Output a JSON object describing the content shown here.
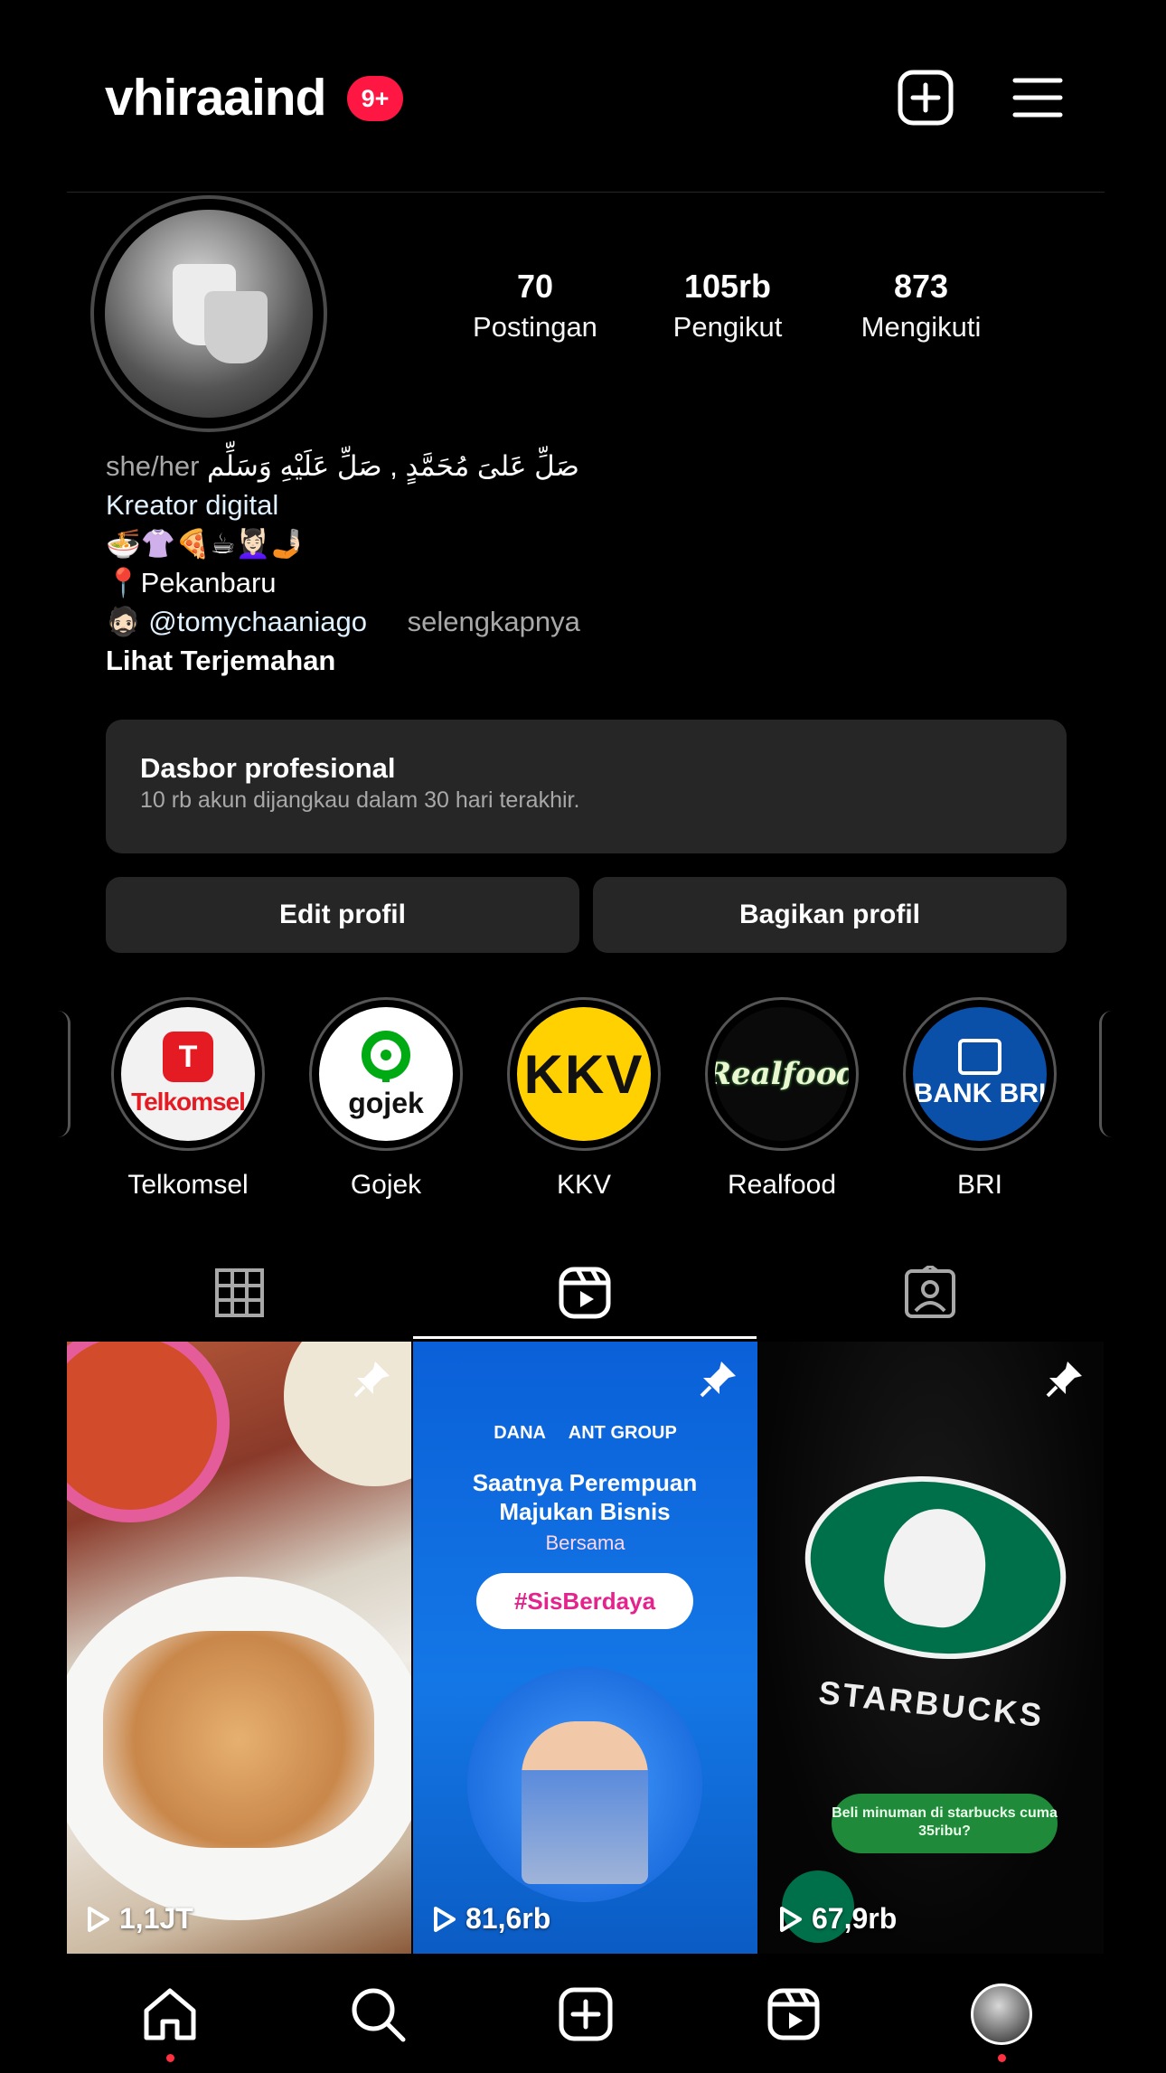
{
  "header": {
    "username": "vhiraaind",
    "notification_badge": "9+",
    "create_icon": "plus-square-icon",
    "menu_icon": "hamburger-icon"
  },
  "stats": [
    {
      "value": "70",
      "label": "Postingan"
    },
    {
      "value": "105rb",
      "label": "Pengikut"
    },
    {
      "value": "873",
      "label": "Mengikuti"
    }
  ],
  "bio": {
    "pronouns": "she/her",
    "arabic": "صَلِّ عَلیَ مُحَمَّدٍ , صَلِّ عَلَيْهِ وَسَلِّم",
    "category": "Kreator digital",
    "emojis": "🍜👚🍕☕💆🏻‍♀️🤳🏻",
    "location": "📍Pekanbaru",
    "partner_emoji": "🧔🏻",
    "partner_handle": "@tomychaaniago",
    "more": "selengkapnya",
    "translate": "Lihat Terjemahan"
  },
  "dashboard": {
    "title": "Dasbor profesional",
    "subtitle": "10 rb akun dijangkau dalam 30 hari terakhir."
  },
  "buttons": {
    "edit": "Edit profil",
    "share": "Bagikan profil"
  },
  "highlights": [
    {
      "name": "Telkomsel",
      "logo_text": "Telkomsel"
    },
    {
      "name": "Gojek",
      "logo_text": "gojek"
    },
    {
      "name": "KKV",
      "logo_text": "KKV"
    },
    {
      "name": "Realfood",
      "logo_text": "Realfood"
    },
    {
      "name": "BRI",
      "logo_text": "BANK BRI"
    }
  ],
  "tabs": [
    "grid-icon",
    "reels-icon",
    "tagged-icon"
  ],
  "reels": [
    {
      "views": "1,1JT",
      "pinned": true
    },
    {
      "views": "81,6rb",
      "pinned": true,
      "brand": "DANA",
      "brand2": "ANT GROUP",
      "headline": "Saatnya Perempuan Majukan Bisnis",
      "sub": "Bersama",
      "tag": "#SisBerdaya"
    },
    {
      "views": "67,9rb",
      "pinned": true,
      "wordmark": "STARBUCKS",
      "caption": "Beli minuman di starbucks cuma 35ribu?"
    }
  ],
  "nav": [
    "home-icon",
    "search-icon",
    "create-icon",
    "reels-icon",
    "profile-avatar"
  ],
  "colors": {
    "background": "#000000",
    "surface": "#262626",
    "badge": "#ff1744",
    "link": "#e0f1ff"
  }
}
